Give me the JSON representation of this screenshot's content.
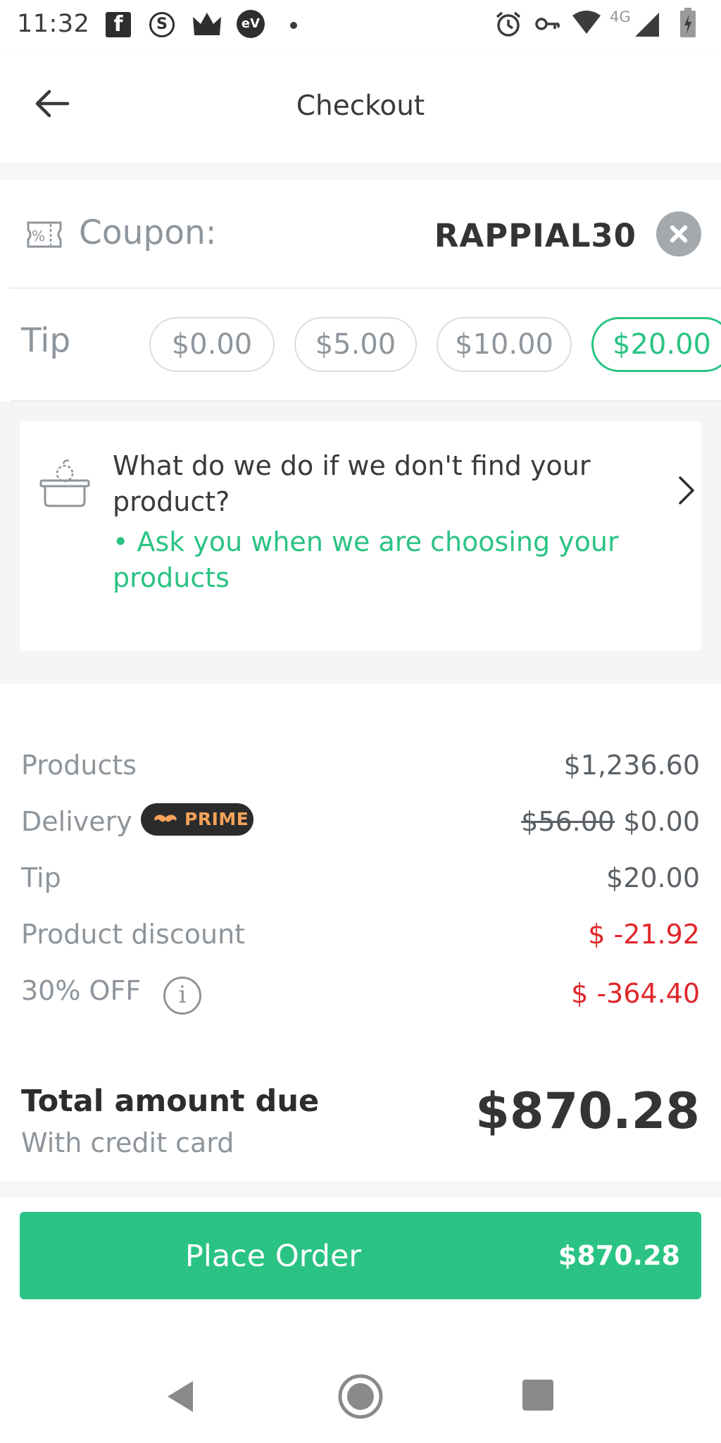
{
  "status_bar": {
    "time": "11:32",
    "network": "4G",
    "icons": [
      "facebook-icon",
      "s-app-icon",
      "crown-app-icon",
      "ev-app-icon",
      "notification-dot-icon",
      "alarm-icon",
      "vpn-key-icon",
      "wifi-icon",
      "signal-icon",
      "battery-charging-icon"
    ]
  },
  "header": {
    "title": "Checkout",
    "back_icon": "arrow-left-icon"
  },
  "coupon": {
    "label": "Coupon:",
    "code": "RAPPIAL30",
    "icon": "coupon-percent-icon",
    "remove_icon": "close-circle-icon"
  },
  "tip": {
    "label": "Tip",
    "options": [
      {
        "label": "$0.00",
        "selected": false
      },
      {
        "label": "$5.00",
        "selected": false
      },
      {
        "label": "$10.00",
        "selected": false
      },
      {
        "label": "$20.00",
        "selected": true
      }
    ]
  },
  "replacement": {
    "question": "What do we do if we don't find your product?",
    "answer": "• Ask you when we are choosing your products",
    "icon": "basket-icon",
    "chevron_icon": "chevron-right-icon"
  },
  "summary": {
    "rows": [
      {
        "label": "Products",
        "value": "$1,236.60"
      },
      {
        "label": "Delivery",
        "badge": "PRIME",
        "original_value": "$56.00",
        "value": "$0.00"
      },
      {
        "label": "Tip",
        "value": "$20.00"
      },
      {
        "label": "Product discount",
        "value": "$ -21.92"
      },
      {
        "label": "30% OFF",
        "value": "$ -364.40"
      }
    ],
    "total_label": "Total amount due",
    "total_sublabel": "With credit card",
    "total_amount": "$870.28"
  },
  "cta": {
    "label": "Place Order",
    "amount": "$870.28"
  },
  "colors": {
    "accent_green": "#2ac384",
    "discount_red": "#e0262a",
    "muted_gray": "#8e959b",
    "prime_orange": "#f5a25a"
  }
}
